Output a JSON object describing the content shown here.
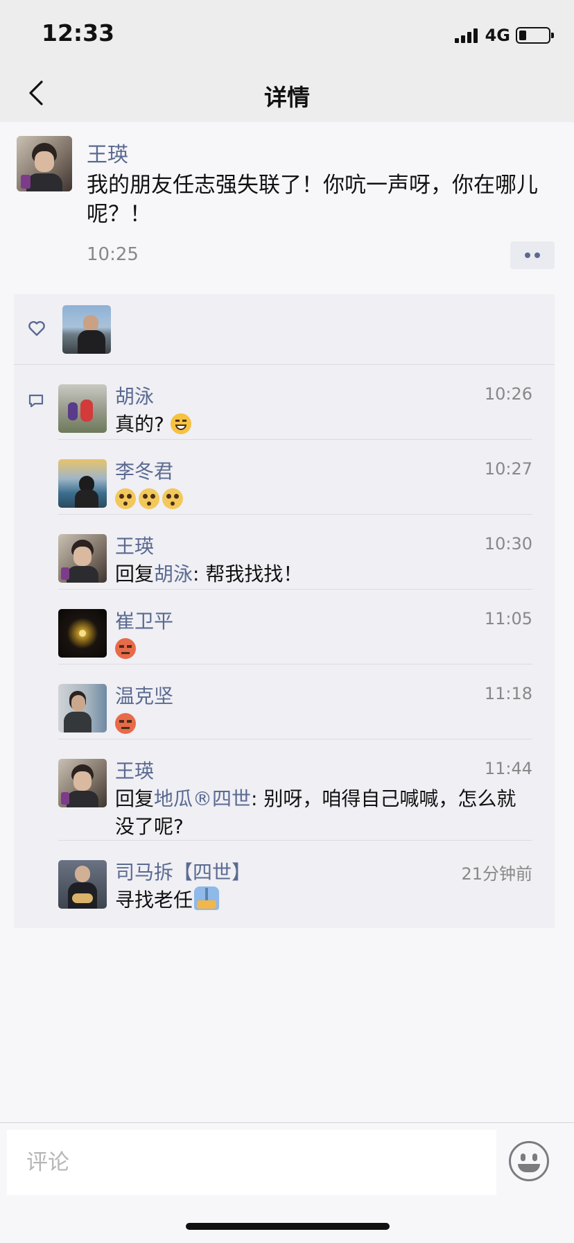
{
  "status_bar": {
    "time": "12:33",
    "network": "4G"
  },
  "nav": {
    "title": "详情"
  },
  "post": {
    "author": "王瑛",
    "text": "我的朋友任志强失联了！你吭一声呀，你在哪儿呢？！",
    "time": "10:25"
  },
  "comments": [
    {
      "author": "胡泳",
      "time": "10:26",
      "text": "真的?",
      "emoji": [
        "grin-icon"
      ]
    },
    {
      "author": "李冬君",
      "time": "10:27",
      "text": "",
      "emoji": [
        "dizzy-icon",
        "dizzy-icon",
        "dizzy-icon"
      ]
    },
    {
      "author": "王瑛",
      "time": "10:30",
      "reply_prefix": "回复",
      "reply_to": "胡泳",
      "text": ": 帮我找找！"
    },
    {
      "author": "崔卫平",
      "time": "11:05",
      "text": "",
      "emoji": [
        "angry-icon"
      ]
    },
    {
      "author": "温克坚",
      "time": "11:18",
      "text": "",
      "emoji": [
        "angry-icon"
      ]
    },
    {
      "author": "王瑛",
      "time": "11:44",
      "reply_prefix": "回复",
      "reply_to": "地瓜®四世",
      "text": ": 别呀，咱得自己喊喊，怎么就没了呢?"
    },
    {
      "author": "司马拆【四世】",
      "time": "21分钟前",
      "text": "寻找老任",
      "emoji": [
        "pray-icon"
      ]
    }
  ],
  "comment_bar": {
    "placeholder": "评论"
  },
  "colors": {
    "link": "#5b6a91",
    "nav_bg": "#ededed",
    "panel_bg": "#efeff4"
  }
}
